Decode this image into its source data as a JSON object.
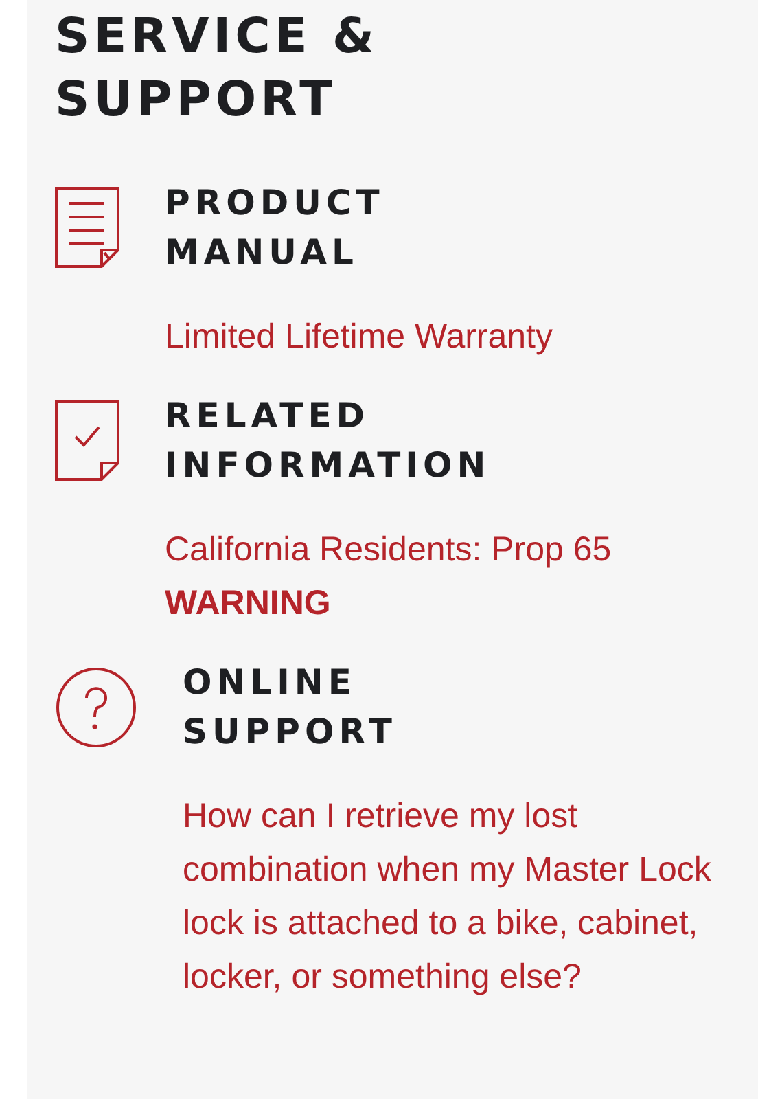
{
  "title": "SERVICE & SUPPORT",
  "sections": [
    {
      "kind": "manual",
      "heading": "PRODUCT MANUAL",
      "link": "Limited Lifetime Warranty"
    },
    {
      "kind": "related",
      "heading": "RELATED INFORMATION",
      "link": "California Residents: Prop 65 **WARNING**"
    },
    {
      "kind": "support",
      "heading": "ONLINE SUPPORT",
      "link": "How can I retrieve my lost combination when my Master Lock lock is attached to a bike, cabinet, locker, or something else?"
    }
  ]
}
